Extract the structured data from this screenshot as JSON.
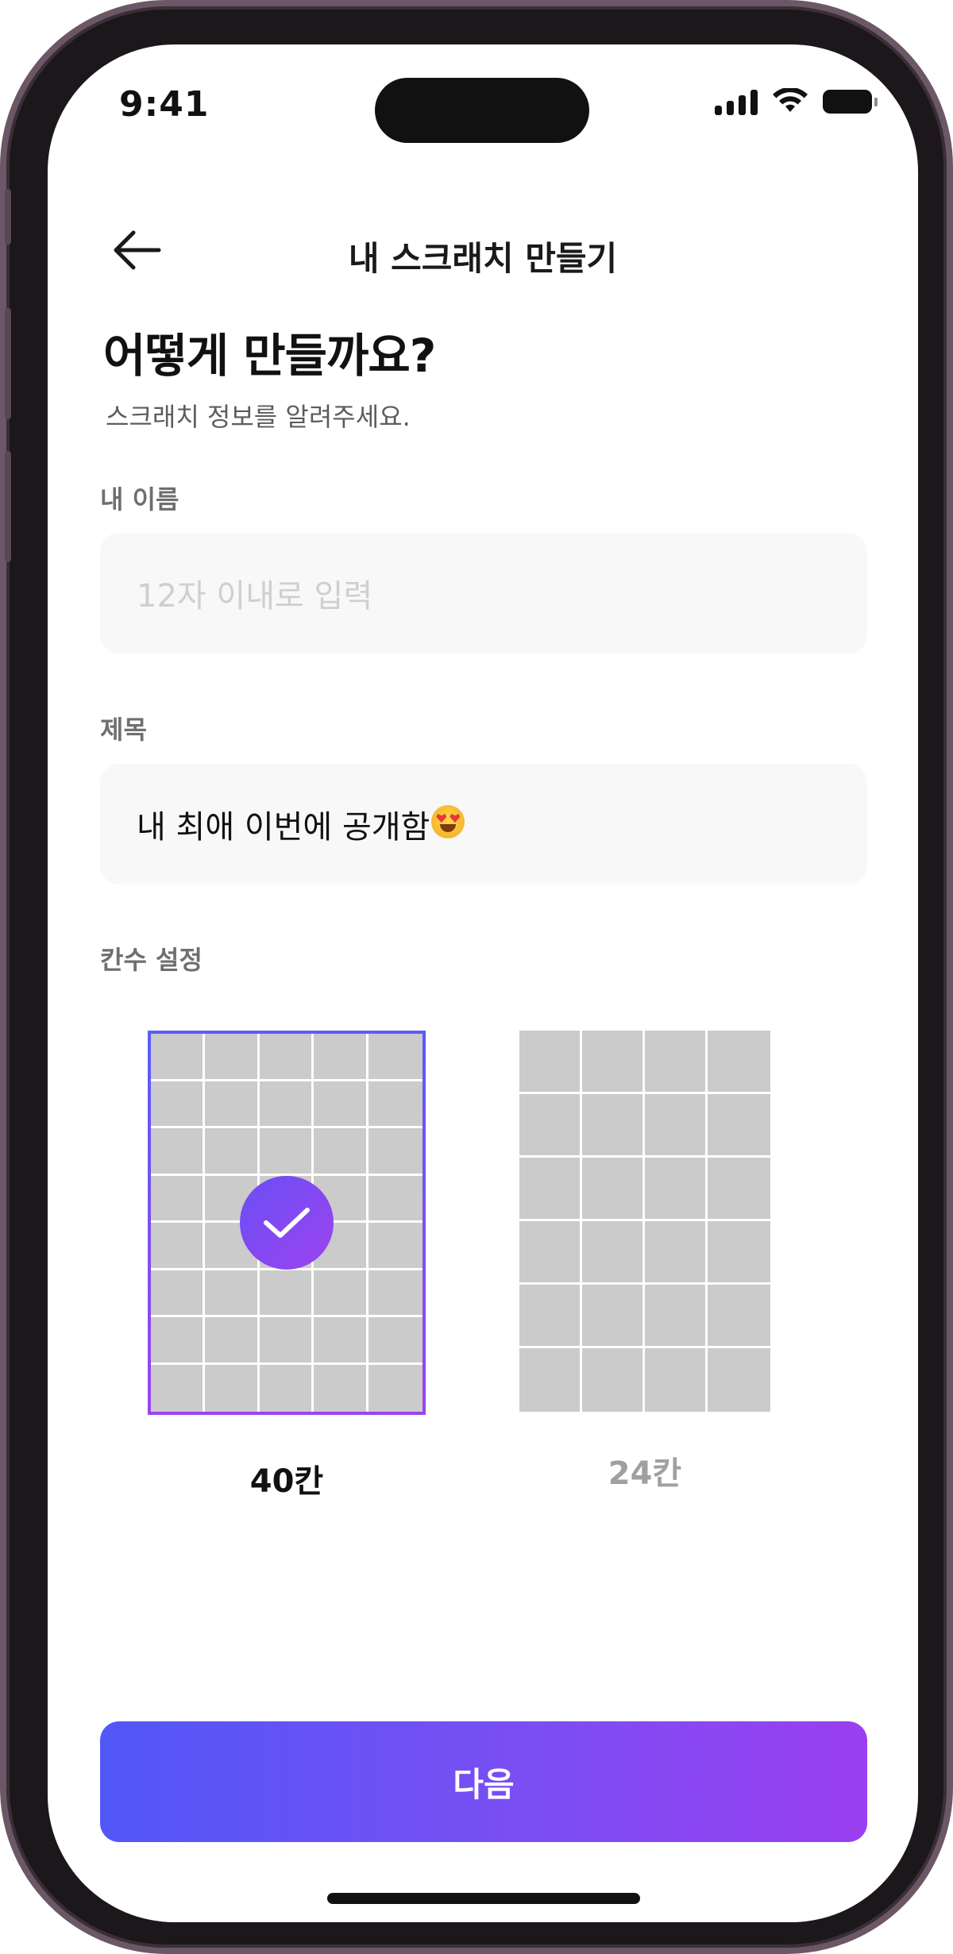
{
  "status_bar": {
    "time": "9:41"
  },
  "nav": {
    "title": "내 스크래치 만들기",
    "back_icon": "arrow-left-icon"
  },
  "heading": {
    "title": "어떻게 만들까요?",
    "subtitle": "스크래치 정보를 알려주세요."
  },
  "form": {
    "name_label": "내 이름",
    "name_placeholder": "12자 이내로 입력",
    "name_value": "",
    "title_label": "제목",
    "title_value": "내 최애 이번에 공개함",
    "title_emoji": "heart-eyes-emoji",
    "grid_label": "칸수 설정"
  },
  "grid_options": [
    {
      "label": "40칸",
      "columns": 5,
      "rows": 8,
      "selected": true
    },
    {
      "label": "24칸",
      "columns": 4,
      "rows": 6,
      "selected": false
    }
  ],
  "footer": {
    "next_label": "다음"
  },
  "colors": {
    "accent_start": "#5157f6",
    "accent_end": "#9a3ff0",
    "cell": "#cbcbcb",
    "field_bg": "#f8f8f8"
  }
}
